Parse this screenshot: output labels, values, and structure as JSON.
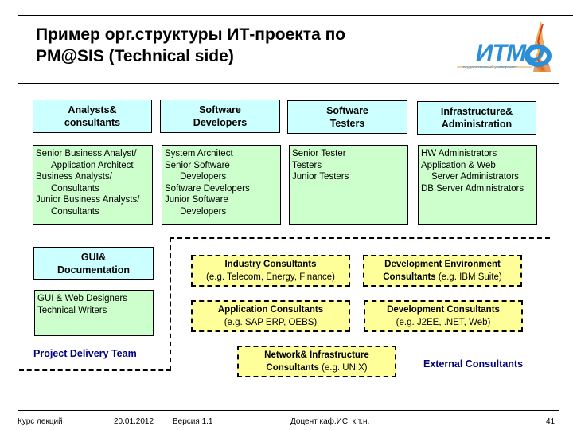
{
  "title": {
    "line1": "Пример орг.структуры ИТ-проекта по",
    "line2": "PM@SIS (Technical side)"
  },
  "logo": {
    "text": "ИТМО",
    "subtitle": "государственный университет",
    "colors": {
      "text": "#2a8fd6",
      "flame": "#e07020"
    }
  },
  "project_team": {
    "label": "Project Delivery Team",
    "groups": [
      {
        "header": [
          "Analysts&",
          "consultants"
        ],
        "roles": [
          {
            "text": "Senior Business Analyst/",
            "indent": false
          },
          {
            "text": "Application Architect",
            "indent": true
          },
          {
            "text": "Business Analysts/",
            "indent": false
          },
          {
            "text": "Consultants",
            "indent": true
          },
          {
            "text": "Junior Business Analysts/",
            "indent": false
          },
          {
            "text": "Consultants",
            "indent": true
          }
        ]
      },
      {
        "header": [
          "Software",
          "Developers"
        ],
        "roles": [
          {
            "text": "System Architect",
            "indent": false
          },
          {
            "text": "Senior Software",
            "indent": false
          },
          {
            "text": "Developers",
            "indent": true
          },
          {
            "text": "Software Developers",
            "indent": false
          },
          {
            "text": "Junior Software",
            "indent": false
          },
          {
            "text": "Developers",
            "indent": true
          }
        ]
      },
      {
        "header": [
          "Software",
          "Testers"
        ],
        "roles": [
          {
            "text": "Senior Tester",
            "indent": false
          },
          {
            "text": "Testers",
            "indent": false
          },
          {
            "text": "Junior Testers",
            "indent": false
          }
        ]
      },
      {
        "header": [
          "Infrastructure&",
          "Administration"
        ],
        "roles": [
          {
            "text": "HW Administrators",
            "indent": false
          },
          {
            "text": "Application & Web",
            "indent": false
          },
          {
            "text": "Server Administrators",
            "indent": true
          },
          {
            "text": "DB Server Administrators",
            "indent": false
          }
        ]
      },
      {
        "header": [
          "GUI&",
          "Documentation"
        ],
        "roles": [
          {
            "text": "GUI & Web Designers",
            "indent": false
          },
          {
            "text": "Technical Writers",
            "indent": false
          }
        ]
      }
    ]
  },
  "external_consultants": {
    "label": "External Consultants",
    "items": [
      {
        "bold": "Industry Consultants",
        "normal": "(e.g. Telecom, Energy, Finance)"
      },
      {
        "bold": "Development Environment",
        "bold2": "Consultants",
        "normal": "(e.g. IBM Suite)"
      },
      {
        "bold": "Application Consultants",
        "normal": "(e.g. SAP ERP, OEBS)"
      },
      {
        "bold": "Development Consultants",
        "normal": "(e.g. J2EE, .NET, Web)"
      },
      {
        "bold": "Network& Infrastructure",
        "bold2": "Consultants",
        "normal": "(e.g. UNIX)"
      }
    ]
  },
  "colors": {
    "header_fill": "#ccffff",
    "role_fill": "#ccffcc",
    "external_fill": "#ffff99",
    "label_color": "#000080"
  },
  "footer": {
    "course": "Курс лекций",
    "date": "20.01.2012",
    "version": "Версия 1.1",
    "author": "Доцент каф.ИС, к.т.н.",
    "page": "41"
  }
}
